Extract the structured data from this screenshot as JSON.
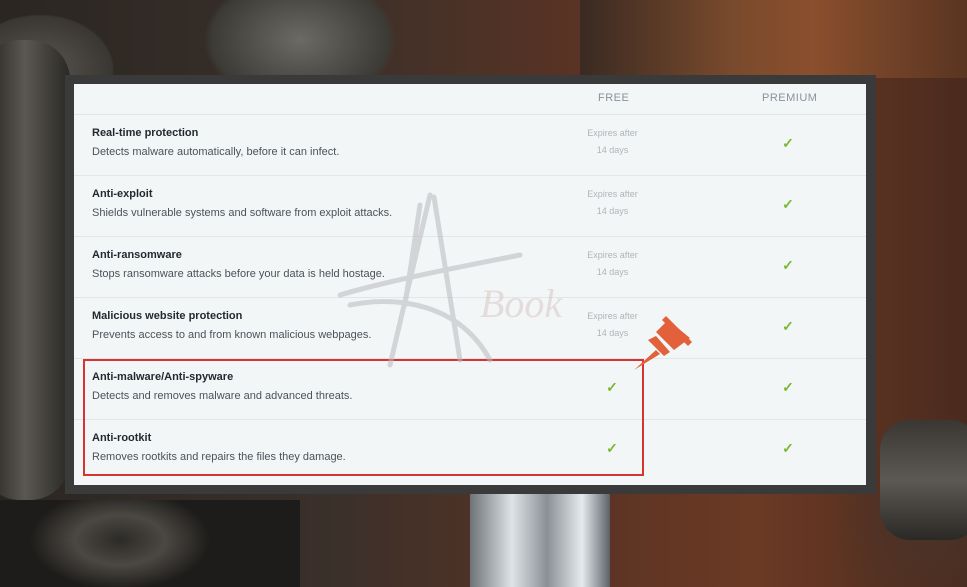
{
  "header": {
    "free": "FREE",
    "premium": "PREMIUM"
  },
  "rows": [
    {
      "title": "Real-time protection",
      "desc": "Detects malware automatically, before it can infect.",
      "free_line1": "Expires after",
      "free_line2": "14 days",
      "premium": "✓"
    },
    {
      "title": "Anti-exploit",
      "desc": "Shields vulnerable systems and software from exploit attacks.",
      "free_line1": "Expires after",
      "free_line2": "14 days",
      "premium": "✓"
    },
    {
      "title": "Anti-ransomware",
      "desc": "Stops ransomware attacks before your data is held hostage.",
      "free_line1": "Expires after",
      "free_line2": "14 days",
      "premium": "✓"
    },
    {
      "title": "Malicious website protection",
      "desc": "Prevents access to and from known malicious webpages.",
      "free_line1": "Expires after",
      "free_line2": "14 days",
      "premium": "✓"
    },
    {
      "title": "Anti-malware/Anti-spyware",
      "desc": "Detects and removes malware and advanced threats.",
      "free": "✓",
      "premium": "✓"
    },
    {
      "title": "Anti-rootkit",
      "desc": "Removes rootkits and repairs the files they damage.",
      "free": "✓",
      "premium": "✓"
    }
  ],
  "watermark": {
    "text": "Book"
  },
  "colors": {
    "check": "#7ab833",
    "highlight": "#d7332f",
    "pin": "#e2603a"
  },
  "icons": {
    "check": "check-icon",
    "pin": "pushpin-icon",
    "watermark": "star-logo-icon"
  }
}
